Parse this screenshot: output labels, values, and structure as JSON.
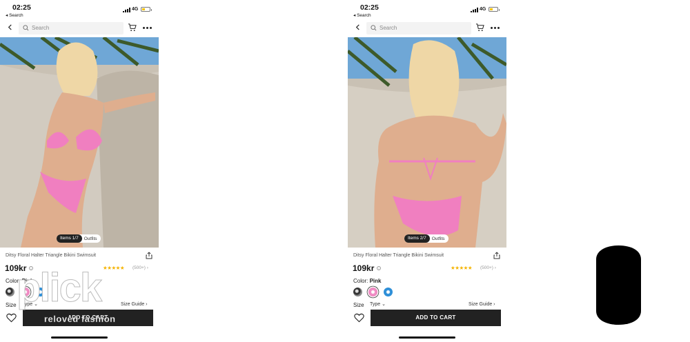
{
  "status_bar": {
    "time": "02:25",
    "back_app": "◂ Search",
    "network": "4G"
  },
  "nav": {
    "search_placeholder": "Search"
  },
  "screens": [
    {
      "pager": {
        "items": "Items 1/7",
        "outfits": "Outfits"
      },
      "product_title": "Ditsy Floral Halter Triangle Bikini Swimsuit",
      "price": "109kr",
      "stars": "★★★★★",
      "rating": "(500+) ›",
      "color_label": "Color:",
      "color_value": "Pink",
      "size_label": "Size",
      "type_dropdown": "Type ⌄",
      "size_guide": "Size Guide ›",
      "add_to_cart": "ADD TO CART"
    },
    {
      "pager": {
        "items": "Items 2/7",
        "outfits": "Outfits"
      },
      "product_title": "Ditsy Floral Halter Triangle Bikini Swimsuit",
      "price": "109kr",
      "stars": "★★★★★",
      "rating": "(500+) ›",
      "color_label": "Color:",
      "color_value": "Pink",
      "size_label": "Size",
      "type_dropdown": "Type ⌄",
      "size_guide": "Size Guide ›",
      "add_to_cart": "ADD TO CART"
    }
  ],
  "watermark": {
    "logo": "plick",
    "tagline": "reloved fashion"
  },
  "swatches": [
    "#3a3a3a",
    "#f08cc4",
    "#2e8fd8"
  ],
  "colors": {
    "accent_star": "#f5b300",
    "button": "#222222"
  }
}
